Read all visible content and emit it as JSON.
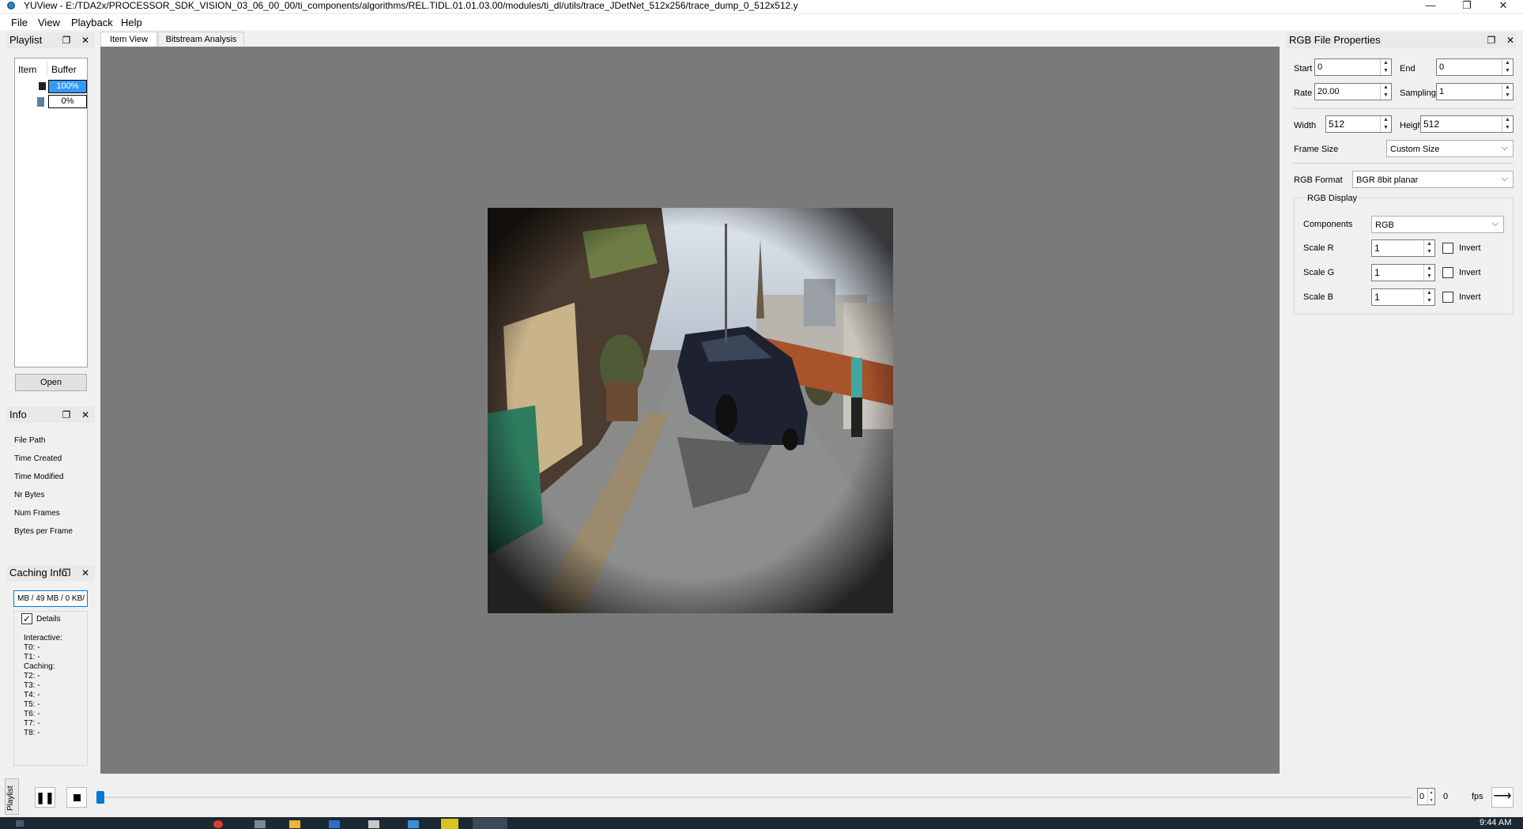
{
  "window": {
    "title": "YUView - E:/TDA2x/PROCESSOR_SDK_VISION_03_06_00_00/ti_components/algorithms/REL.TIDL.01.01.03.00/modules/ti_dl/utils/trace_JDetNet_512x256/trace_dump_0_512x512.y",
    "minimize": "—",
    "restore": "❐",
    "close": "✕"
  },
  "menu": {
    "file": "File",
    "view": "View",
    "playback": "Playback",
    "help": "Help"
  },
  "playlist": {
    "title": "Playlist",
    "col_item": "Item",
    "col_buffer": "Buffer",
    "rows": [
      {
        "buffer": "100%"
      },
      {
        "buffer": "0%"
      }
    ],
    "open_label": "Open"
  },
  "info": {
    "title": "Info",
    "fields": [
      "File Path",
      "Time Created",
      "Time Modified",
      "Nr Bytes",
      "Num Frames",
      "Bytes per Frame"
    ]
  },
  "caching": {
    "title": "Caching Info",
    "summary": "MB / 49 MB / 0 KB/",
    "details_label": "Details",
    "details_checked": true,
    "lines": [
      "Interactive:",
      "T0: -",
      "T1: -",
      "Caching:",
      "T2: -",
      "T3: -",
      "T4: -",
      "T5: -",
      "T6: -",
      "T7: -",
      "T8: -"
    ]
  },
  "tabs": {
    "item_view": "Item View",
    "bitstream": "Bitstream Analysis"
  },
  "props": {
    "title": "RGB File Properties",
    "start_label": "Start",
    "start_value": "0",
    "end_label": "End",
    "end_value": "0",
    "rate_label": "Rate",
    "rate_value": "20.00",
    "sampling_label": "Sampling",
    "sampling_value": "1",
    "width_label": "Width",
    "width_value": "512",
    "height_label": "Height",
    "height_value": "512",
    "frame_size_label": "Frame Size",
    "frame_size_value": "Custom Size",
    "rgb_format_label": "RGB Format",
    "rgb_format_value": "BGR 8bit planar",
    "rgb_display_label": "RGB Display",
    "components_label": "Components",
    "components_value": "RGB",
    "scale_r_label": "Scale R",
    "scale_r_value": "1",
    "scale_g_label": "Scale G",
    "scale_g_value": "1",
    "scale_b_label": "Scale B",
    "scale_b_value": "1",
    "invert_label": "Invert"
  },
  "playback": {
    "side_label": "Playlist",
    "frame_value": "0",
    "frame_count": "0",
    "fps_label": "fps"
  },
  "taskbar": {
    "time": "9:44 AM"
  },
  "colors": {
    "accent": "#0078d7",
    "view_bg": "#7a7a7a"
  }
}
